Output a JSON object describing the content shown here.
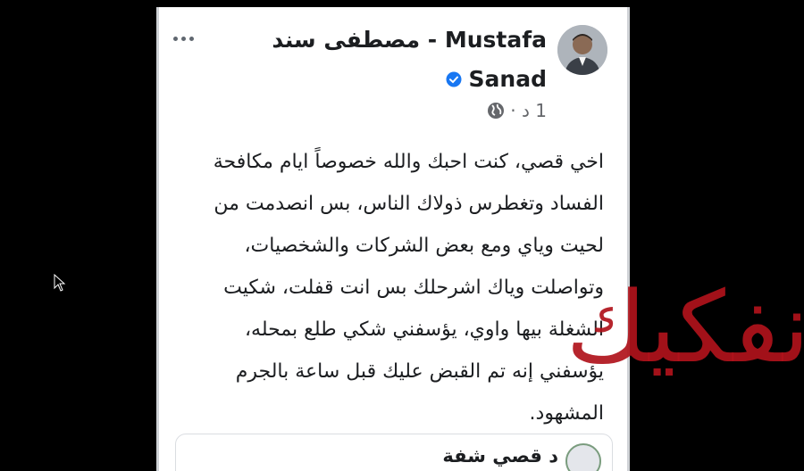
{
  "post": {
    "author_line1": "مصطفى سند - Mustafa",
    "author_line2": "Sanad",
    "time": "1 د ·",
    "lines": [
      "اخي قصي، كنت احبك والله خصوصاً ايام مكافحة",
      "الفساد وتغطرس ذولاك الناس، بس انصدمت من",
      "لحيت وياي ومع بعض الشركات والشخصيات،",
      "وتواصلت وياك اشرحلك بس انت قفلت، شكيت",
      "الشغلة بيها واوي، يؤسفني شكي طلع بمحله،",
      "يؤسفني إنه تم القبض عليك قبل ساعة بالجرم",
      "المشهود."
    ],
    "icons": {
      "more": "more-options-icon",
      "verified": "verified-badge-icon",
      "privacy": "globe-icon"
    },
    "colors": {
      "verified": "#1877f2",
      "text": "#1c1e21",
      "meta": "#65676b"
    }
  },
  "comment": {
    "name": "د قصي شفة"
  },
  "watermark": {
    "text": "نفكيك",
    "color": "#b0121b"
  }
}
